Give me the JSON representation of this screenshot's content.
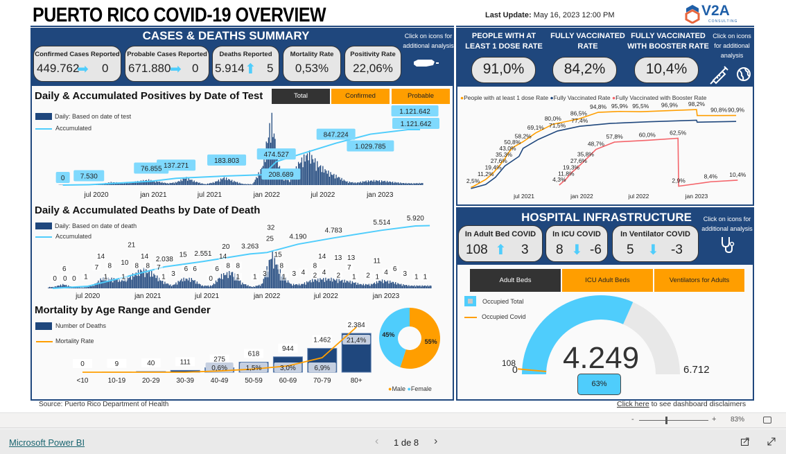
{
  "header": {
    "title": "PUERTO RICO COVID-19 OVERVIEW",
    "last_update_label": "Last Update:",
    "last_update_value": "May 16, 2023 12:00 PM",
    "logo_text": "V2A",
    "logo_sub": "CONSULTING"
  },
  "summary": {
    "title": "CASES & DEATHS SUMMARY",
    "hint": "Click on icons for additional analysis",
    "map_icon": "puerto-rico-map-icon",
    "cards": [
      {
        "label": "Confirmed Cases Reported",
        "value": "449.762",
        "trend": "right",
        "delta": "0"
      },
      {
        "label": "Probable Cases Reported",
        "value": "671.880",
        "trend": "right",
        "delta": "0"
      },
      {
        "label": "Deaths Reported",
        "value": "5.914",
        "trend": "up",
        "delta": "5"
      },
      {
        "label": "Mortality Rate",
        "value": "0,53%"
      },
      {
        "label": "Positivity Rate",
        "value": "22,06%"
      }
    ]
  },
  "positives": {
    "title": "Daily & Accumulated Positives by Date of Test",
    "tabs": [
      "Total",
      "Confirmed",
      "Probable"
    ],
    "active_tab": "Total",
    "legend_daily": "Daily: Based on date of test",
    "legend_accum": "Accumulated"
  },
  "deaths": {
    "title": "Daily & Accumulated Deaths by Date of Death",
    "legend_daily": "Daily: Based on date of death",
    "legend_accum": "Accumulated"
  },
  "mortality": {
    "title": "Mortality by Age Range and Gender",
    "legend_deaths": "Number of Deaths",
    "legend_rate": "Mortality Rate",
    "legend_male": "Male",
    "legend_female": "Female"
  },
  "vaccination": {
    "hint": "Click on icons for additional analysis",
    "kpis": [
      {
        "label": "PEOPLE WITH AT LEAST 1 DOSE RATE",
        "value": "91,0%"
      },
      {
        "label": "FULLY VACCINATED RATE",
        "value": "84,2%"
      },
      {
        "label": "FULLY VACCINATED WITH BOOSTER RATE",
        "value": "10,4%"
      }
    ],
    "icons": [
      "syringe-icon",
      "globe-icon"
    ]
  },
  "hospital": {
    "title": "HOSPITAL INFRASTRUCTURE",
    "hint": "Click on icons for additional analysis",
    "cards": [
      {
        "label": "In Adult Bed COVID",
        "value": "108",
        "trend": "up",
        "delta": "3"
      },
      {
        "label": "In ICU COVID",
        "value": "8",
        "trend": "down",
        "delta": "-6"
      },
      {
        "label": "In Ventilator COVID",
        "value": "5",
        "trend": "down",
        "delta": "-3"
      }
    ],
    "tabs": [
      "Adult Beds",
      "ICU Adult Beds",
      "Ventilators for Adults"
    ],
    "active_tab": "Adult Beds",
    "legend_total": "Occupied Total",
    "legend_covid": "Occupied Covid",
    "gauge": {
      "value": "4.249",
      "min": "0",
      "max": "6.712",
      "target": "108",
      "percent": "63%",
      "fraction": 0.633,
      "target_fraction": 0.016
    }
  },
  "footer": {
    "source": "Source: Puerto Rico Department of Health",
    "disclaimer_link": "Click here",
    "disclaimer_text": " to see dashboard disclaimers"
  },
  "viewer": {
    "zoom_minus": "-",
    "zoom_plus": "+",
    "zoom": "83%",
    "brand": "Microsoft Power BI",
    "page": "1 de 8",
    "prev": "‹",
    "next": "›"
  },
  "colors": {
    "navy": "#1f477d",
    "light_blue": "#4fcdfc",
    "orange": "#ff9e00",
    "dark_tab": "#333333",
    "booster_red": "#f4646a"
  },
  "chart_data": [
    {
      "id": "positives",
      "type": "bar+line",
      "x_ticks": [
        "jul 2020",
        "jan 2021",
        "jul 2021",
        "jan 2022",
        "jul 2022",
        "jan 2023"
      ],
      "daily_monthly": [
        [
          "2020-03",
          50
        ],
        [
          "2020-04",
          60
        ],
        [
          "2020-05",
          30
        ],
        [
          "2020-06",
          60
        ],
        [
          "2020-07",
          200
        ],
        [
          "2020-08",
          500
        ],
        [
          "2020-09",
          400
        ],
        [
          "2020-10",
          400
        ],
        [
          "2020-11",
          700
        ],
        [
          "2020-12",
          900
        ],
        [
          "2021-01",
          600
        ],
        [
          "2021-02",
          300
        ],
        [
          "2021-03",
          500
        ],
        [
          "2021-04",
          1300
        ],
        [
          "2021-05",
          600
        ],
        [
          "2021-06",
          150
        ],
        [
          "2021-07",
          500
        ],
        [
          "2021-08",
          1300
        ],
        [
          "2021-09",
          700
        ],
        [
          "2021-10",
          200
        ],
        [
          "2021-11",
          150
        ],
        [
          "2021-12",
          3000
        ],
        [
          "2022-01",
          11500
        ],
        [
          "2022-02",
          1500
        ],
        [
          "2022-03",
          700
        ],
        [
          "2022-04",
          4000
        ],
        [
          "2022-05",
          5500
        ],
        [
          "2022-06",
          3500
        ],
        [
          "2022-07",
          2300
        ],
        [
          "2022-08",
          1500
        ],
        [
          "2022-09",
          600
        ],
        [
          "2022-10",
          400
        ],
        [
          "2022-11",
          700
        ],
        [
          "2022-12",
          800
        ],
        [
          "2023-01",
          700
        ],
        [
          "2023-02",
          500
        ],
        [
          "2023-03",
          350
        ],
        [
          "2023-04",
          300
        ],
        [
          "2023-05",
          350
        ]
      ],
      "accumulated": [
        [
          "2020-03-15",
          0,
          "0"
        ],
        [
          "2020-06-07",
          7530,
          "7.530"
        ],
        [
          "2020-12-25",
          76855,
          "76.855"
        ],
        [
          "2021-03-15",
          137271,
          "137.271"
        ],
        [
          "2021-08-25",
          183803,
          "183.803"
        ],
        [
          "2021-12-20",
          208689,
          "208.689"
        ],
        [
          "2022-02-01",
          474527,
          "474.527"
        ],
        [
          "2022-08-12",
          847224,
          "847.224"
        ],
        [
          "2022-12-01",
          1029785,
          "1.029.785"
        ],
        [
          "2023-04-01",
          1121642,
          "1.121.642"
        ],
        [
          "2023-05-10",
          1121642,
          "1.121.642"
        ]
      ]
    },
    {
      "id": "deaths",
      "type": "bar+line",
      "x_ticks": [
        "jul 2020",
        "jan 2021",
        "jul 2021",
        "jan 2022",
        "jul 2022",
        "jan 2023"
      ],
      "daily_monthly": [
        [
          "2020-03",
          1
        ],
        [
          "2020-04",
          3
        ],
        [
          "2020-05",
          1
        ],
        [
          "2020-06",
          0.5
        ],
        [
          "2020-07",
          2
        ],
        [
          "2020-08",
          8
        ],
        [
          "2020-09",
          7
        ],
        [
          "2020-10",
          6
        ],
        [
          "2020-11",
          10
        ],
        [
          "2020-12",
          14
        ],
        [
          "2021-01",
          11
        ],
        [
          "2021-02",
          5
        ],
        [
          "2021-03",
          2
        ],
        [
          "2021-04",
          7
        ],
        [
          "2021-05",
          7
        ],
        [
          "2021-06",
          2
        ],
        [
          "2021-07",
          2
        ],
        [
          "2021-08",
          10
        ],
        [
          "2021-09",
          12
        ],
        [
          "2021-10",
          4
        ],
        [
          "2021-11",
          1
        ],
        [
          "2021-12",
          3
        ],
        [
          "2022-01",
          26
        ],
        [
          "2022-02",
          10
        ],
        [
          "2022-03",
          3
        ],
        [
          "2022-04",
          3
        ],
        [
          "2022-05",
          6
        ],
        [
          "2022-06",
          7
        ],
        [
          "2022-07",
          7
        ],
        [
          "2022-08",
          6
        ],
        [
          "2022-09",
          5
        ],
        [
          "2022-10",
          3
        ],
        [
          "2022-11",
          3
        ],
        [
          "2022-12",
          6
        ],
        [
          "2023-01",
          5
        ],
        [
          "2023-02",
          3
        ],
        [
          "2023-03",
          2
        ],
        [
          "2023-04",
          2
        ],
        [
          "2023-05",
          2
        ]
      ],
      "daily_labels": [
        [
          "2020-03-22",
          0
        ],
        [
          "2020-04-20",
          6
        ],
        [
          "2020-04-22",
          0
        ],
        [
          "2020-05-20",
          0
        ],
        [
          "2020-06-25",
          1
        ],
        [
          "2020-07-28",
          7
        ],
        [
          "2020-08-10",
          14
        ],
        [
          "2020-08-25",
          1
        ],
        [
          "2020-09-06",
          8
        ],
        [
          "2020-10-18",
          1
        ],
        [
          "2020-10-22",
          10
        ],
        [
          "2020-11-12",
          21
        ],
        [
          "2020-11-28",
          8
        ],
        [
          "2020-12-22",
          14
        ],
        [
          "2021-01-01",
          8
        ],
        [
          "2021-02-03",
          7
        ],
        [
          "2021-02-18",
          1
        ],
        [
          "2021-03-20",
          3
        ],
        [
          "2021-04-19",
          15
        ],
        [
          "2021-04-28",
          6
        ],
        [
          "2021-05-25",
          6
        ],
        [
          "2021-07-13",
          0
        ],
        [
          "2021-08-01",
          6
        ],
        [
          "2021-08-19",
          14
        ],
        [
          "2021-08-28",
          20
        ],
        [
          "2021-09-04",
          8
        ],
        [
          "2021-10-04",
          8
        ],
        [
          "2021-10-04",
          1
        ],
        [
          "2021-11-25",
          1
        ],
        [
          "2021-12-25",
          3
        ],
        [
          "2022-01-10",
          25
        ],
        [
          "2022-01-13",
          32
        ],
        [
          "2022-02-04",
          15
        ],
        [
          "2022-02-15",
          8
        ],
        [
          "2022-02-22",
          1
        ],
        [
          "2022-03-25",
          3
        ],
        [
          "2022-04-22",
          4
        ],
        [
          "2022-05-28",
          8
        ],
        [
          "2022-05-28",
          2
        ],
        [
          "2022-06-19",
          14
        ],
        [
          "2022-06-25",
          4
        ],
        [
          "2022-08-07",
          13
        ],
        [
          "2022-08-08",
          2
        ],
        [
          "2022-09-10",
          7
        ],
        [
          "2022-09-16",
          13
        ],
        [
          "2022-09-25",
          1
        ],
        [
          "2022-11-07",
          2
        ],
        [
          "2022-12-04",
          11
        ],
        [
          "2022-12-05",
          1
        ],
        [
          "2023-01-01",
          4
        ],
        [
          "2023-01-28",
          6
        ],
        [
          "2023-02-28",
          3
        ],
        [
          "2023-04-04",
          1
        ],
        [
          "2023-05-01",
          1
        ]
      ],
      "accumulated": [
        [
          "2020-03-15",
          0,
          ""
        ],
        [
          "2020-07-01",
          200,
          ""
        ],
        [
          "2020-10-01",
          900,
          ""
        ],
        [
          "2021-02-21",
          2038,
          "2.038"
        ],
        [
          "2021-06-19",
          2551,
          "2.551"
        ],
        [
          "2021-11-10",
          3263,
          "3.263"
        ],
        [
          "2022-01-01",
          3400,
          ""
        ],
        [
          "2022-04-06",
          4190,
          "4.190"
        ],
        [
          "2022-07-24",
          4783,
          "4.783"
        ],
        [
          "2022-12-19",
          5514,
          "5.514"
        ],
        [
          "2023-04-01",
          5920,
          "5.920"
        ],
        [
          "2023-05-15",
          5950,
          ""
        ]
      ]
    },
    {
      "id": "mortality",
      "type": "bar+line",
      "categories": [
        "<10",
        "10-19",
        "20-29",
        "30-39",
        "40-49",
        "50-59",
        "60-69",
        "70-79",
        "80+"
      ],
      "deaths": [
        0,
        9,
        40,
        111,
        275,
        618,
        944,
        1462,
        2384
      ],
      "deaths_labels": [
        "0",
        "9",
        "40",
        "111",
        "275",
        "618",
        "944",
        "1.462",
        "2.384"
      ],
      "rate": [
        null,
        null,
        null,
        null,
        0.6,
        1.5,
        3.0,
        6.9,
        21.4
      ],
      "rate_labels": [
        "",
        "",
        "",
        "",
        "0,6%",
        "1,5%",
        "3,0%",
        "6,9%",
        "21,4%"
      ]
    },
    {
      "id": "gender",
      "type": "pie",
      "slices": [
        {
          "name": "Male",
          "value": 55,
          "label": "55%",
          "color": "#ff9e00"
        },
        {
          "name": "Female",
          "value": 45,
          "label": "45%",
          "color": "#4fcdfc"
        }
      ],
      "legend": "bottom"
    },
    {
      "id": "vaccination",
      "type": "line",
      "x_ticks": [
        "jul 2021",
        "jan 2022",
        "jul 2022",
        "jan 2023"
      ],
      "series": [
        {
          "name": "People with at least 1 dose Rate",
          "color": "#ff9e00",
          "points": [
            [
              "2021-01-13",
              1.5,
              ""
            ],
            [
              "2021-01-20",
              2.5,
              "2,5%"
            ],
            [
              "2021-03-01",
              11.2,
              "11,2%"
            ],
            [
              "2021-03-25",
              19.4,
              "19,4%"
            ],
            [
              "2021-04-12",
              27.6,
              "27,6%"
            ],
            [
              "2021-04-28",
              35.3,
              "35,3%"
            ],
            [
              "2021-05-10",
              43.0,
              "43,0%"
            ],
            [
              "2021-05-25",
              50.8,
              "50,8%"
            ],
            [
              "2021-06-28",
              58.2,
              "58,2%"
            ],
            [
              "2021-08-07",
              69.1,
              "69,1%"
            ],
            [
              "2021-10-01",
              80.0,
              "80,0%"
            ],
            [
              "2021-12-22",
              86.5,
              "86,5%"
            ],
            [
              "2022-02-22",
              94.8,
              "94,8%"
            ],
            [
              "2022-05-01",
              95.9,
              "95,9%"
            ],
            [
              "2022-07-07",
              95.5,
              "95,5%"
            ],
            [
              "2022-10-07",
              96.9,
              "96,9%"
            ],
            [
              "2023-01-01",
              98.2,
              "98,2%"
            ],
            [
              "2023-01-03",
              90.8,
              ""
            ],
            [
              "2023-03-13",
              90.8,
              "90,8%"
            ],
            [
              "2023-05-07",
              90.9,
              "90,9%"
            ]
          ]
        },
        {
          "name": "Fully Vaccinated Rate",
          "color": "#1f477d",
          "points": [
            [
              "2021-01-13",
              0,
              ""
            ],
            [
              "2021-03-01",
              5,
              ""
            ],
            [
              "2021-04-01",
              14,
              ""
            ],
            [
              "2021-05-01",
              28,
              ""
            ],
            [
              "2021-06-15",
              40,
              ""
            ],
            [
              "2021-06-28",
              50,
              ""
            ],
            [
              "2021-08-15",
              61,
              ""
            ],
            [
              "2021-10-15",
              71.5,
              "71,5%"
            ],
            [
              "2021-12-25",
              77.4,
              "77,4%"
            ],
            [
              "2022-04-01",
              81,
              ""
            ],
            [
              "2022-08-01",
              83,
              ""
            ],
            [
              "2023-01-01",
              85,
              ""
            ],
            [
              "2023-01-03",
              82.5,
              ""
            ],
            [
              "2023-05-07",
              83.5,
              ""
            ]
          ]
        },
        {
          "name": "Fully Vaccinated with Booster Rate",
          "color": "#f4646a",
          "points": [
            [
              "2021-10-21",
              4.3,
              "4,3%"
            ],
            [
              "2021-11-12",
              11.8,
              "11,8%"
            ],
            [
              "2021-11-28",
              19.3,
              "19,3%"
            ],
            [
              "2021-12-22",
              27.6,
              "27,6%"
            ],
            [
              "2022-01-13",
              35.8,
              "35,8%"
            ],
            [
              "2022-02-15",
              48.7,
              "48,7%"
            ],
            [
              "2022-04-15",
              57.8,
              "57,8%"
            ],
            [
              "2022-07-28",
              60.0,
              "60,0%"
            ],
            [
              "2022-11-03",
              62.5,
              "62,5%"
            ],
            [
              "2022-11-05",
              2.9,
              "2,9%"
            ],
            [
              "2023-02-15",
              8.4,
              "8,4%"
            ],
            [
              "2023-05-12",
              10.4,
              "10,4%"
            ]
          ]
        }
      ],
      "legend": "top"
    }
  ]
}
